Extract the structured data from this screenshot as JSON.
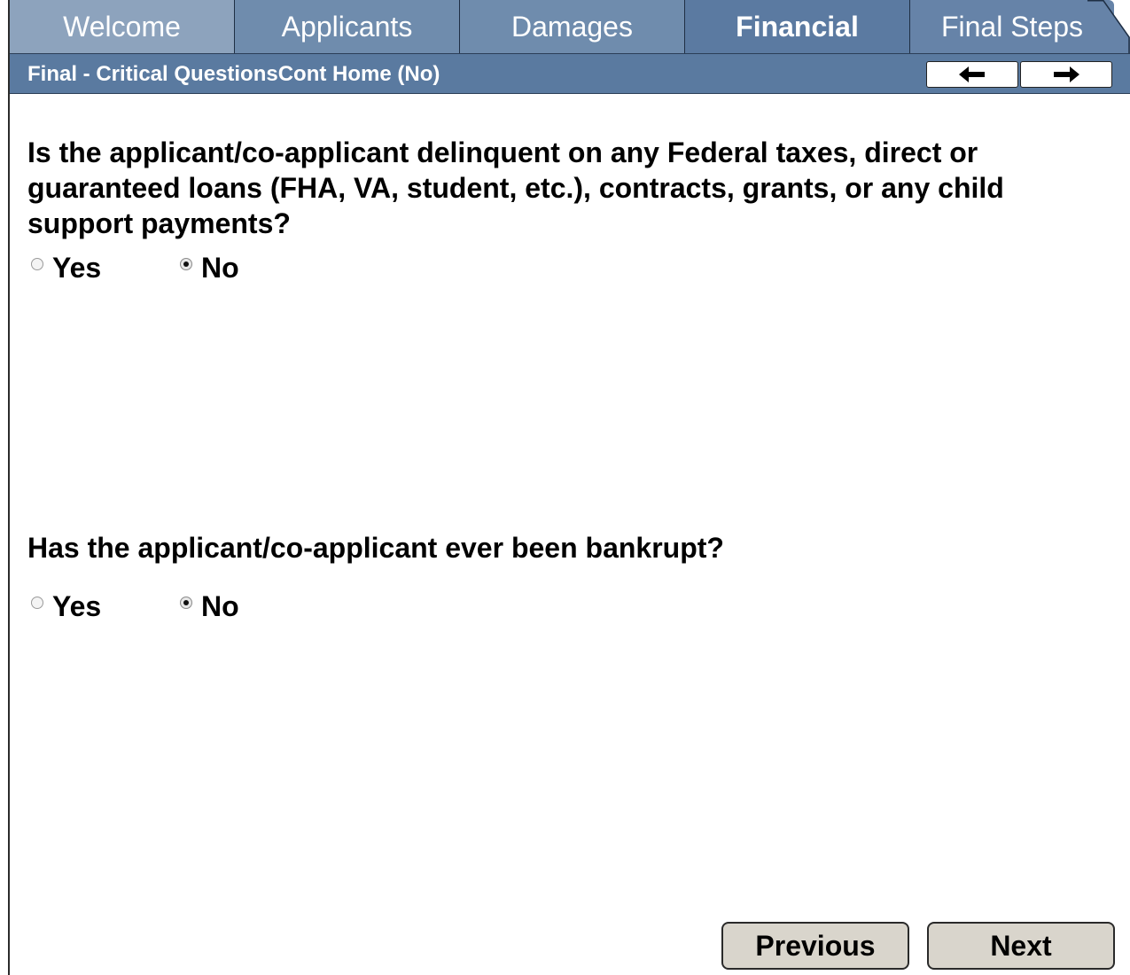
{
  "tabs": [
    {
      "label": "Welcome"
    },
    {
      "label": "Applicants"
    },
    {
      "label": "Damages"
    },
    {
      "label": "Financial",
      "active": true
    },
    {
      "label": "Final Steps"
    }
  ],
  "subheader": {
    "title": "Final - Critical QuestionsCont Home (No)",
    "back_icon": "arrow-left-icon",
    "forward_icon": "arrow-right-icon"
  },
  "questions": [
    {
      "text": "Is the applicant/co-applicant delinquent on any Federal taxes, direct or guaranteed loans (FHA, VA, student, etc.), contracts, grants, or any child support payments?",
      "options": [
        "Yes",
        "No"
      ],
      "selected": "No"
    },
    {
      "text": "Has the applicant/co-applicant ever been bankrupt?",
      "options": [
        "Yes",
        "No"
      ],
      "selected": "No"
    }
  ],
  "footer": {
    "previous_label": "Previous",
    "next_label": "Next"
  },
  "colors": {
    "tab_bg": "#6f8cad",
    "subheader_bg": "#5a7aa0",
    "button_bg": "#d9d5cc"
  }
}
